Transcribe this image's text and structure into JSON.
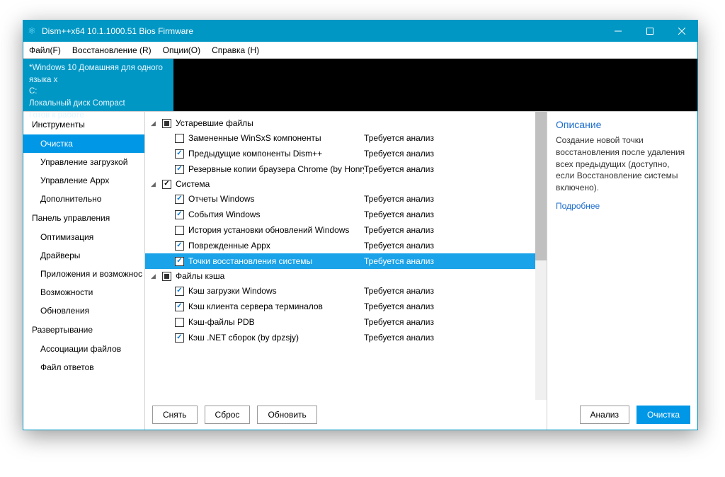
{
  "window": {
    "title": "Dism++x64 10.1.1000.51 Bios Firmware"
  },
  "menubar": [
    "Файл(F)",
    "Восстановление (R)",
    "Опции(O)",
    "Справка (H)"
  ],
  "info": {
    "line1": "*Windows 10 Домашняя для одного языка x",
    "line2": "C:",
    "line3": "Локальный диск Compact",
    "line4": "Готов к работе"
  },
  "sidebar": [
    {
      "type": "head",
      "label": "Инструменты"
    },
    {
      "type": "item",
      "label": "Очистка",
      "active": true
    },
    {
      "type": "item",
      "label": "Управление загрузкой"
    },
    {
      "type": "item",
      "label": "Управление Appx"
    },
    {
      "type": "item",
      "label": "Дополнительно"
    },
    {
      "type": "head",
      "label": "Панель управления"
    },
    {
      "type": "item",
      "label": "Оптимизация"
    },
    {
      "type": "item",
      "label": "Драйверы"
    },
    {
      "type": "item",
      "label": "Приложения и возможнос"
    },
    {
      "type": "item",
      "label": "Возможности"
    },
    {
      "type": "item",
      "label": "Обновления"
    },
    {
      "type": "head",
      "label": "Развертывание"
    },
    {
      "type": "item",
      "label": "Ассоциации файлов"
    },
    {
      "type": "item",
      "label": "Файл ответов"
    }
  ],
  "tree": [
    {
      "type": "cat",
      "label": "Устаревшие файлы",
      "state": "indeterminate"
    },
    {
      "type": "item",
      "label": "Замененные WinSxS компоненты",
      "status": "Требуется анализ",
      "checked": false
    },
    {
      "type": "item",
      "label": "Предыдущие компоненты Dism++",
      "status": "Требуется анализ",
      "checked": true
    },
    {
      "type": "item",
      "label": "Резервные копии браузера Chrome (by Honry",
      "status": "Требуется анализ",
      "checked": true
    },
    {
      "type": "cat",
      "label": "Система",
      "state": "checked"
    },
    {
      "type": "item",
      "label": "Отчеты Windows",
      "status": "Требуется анализ",
      "checked": true
    },
    {
      "type": "item",
      "label": "События Windows",
      "status": "Требуется анализ",
      "checked": true
    },
    {
      "type": "item",
      "label": "История установки обновлений Windows",
      "status": "Требуется анализ",
      "checked": false
    },
    {
      "type": "item",
      "label": "Поврежденные Appx",
      "status": "Требуется анализ",
      "checked": true
    },
    {
      "type": "item",
      "label": "Точки восстановления системы",
      "status": "Требуется анализ",
      "checked": true,
      "selected": true
    },
    {
      "type": "cat",
      "label": "Файлы кэша",
      "state": "indeterminate"
    },
    {
      "type": "item",
      "label": "Кэш загрузки Windows",
      "status": "Требуется анализ",
      "checked": true
    },
    {
      "type": "item",
      "label": "Кэш клиента сервера терминалов",
      "status": "Требуется анализ",
      "checked": true
    },
    {
      "type": "item",
      "label": "Кэш-файлы PDB",
      "status": "Требуется анализ",
      "checked": false
    },
    {
      "type": "item",
      "label": "Кэш .NET сборок (by dpzsjy)",
      "status": "Требуется анализ",
      "checked": true
    }
  ],
  "center_buttons": {
    "clear": "Снять",
    "reset": "Сброс",
    "refresh": "Обновить"
  },
  "right": {
    "head": "Описание",
    "text": "Создание новой точки восстановления после удаления всех предыдущих (доступно, если Восстановление системы включено).",
    "link": "Подробнее",
    "analyze": "Анализ",
    "clean": "Очистка"
  }
}
